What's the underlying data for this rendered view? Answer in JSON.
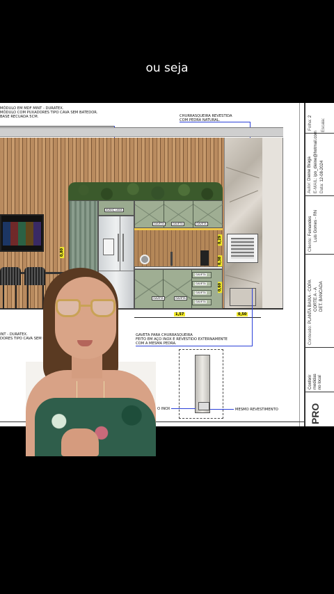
{
  "caption": "ou seja",
  "notes": {
    "top_left": "MÓDULO EM MDF MINT - DURATEX.\nMÓDULO COM PUXADORES TIPO CAVA SEM BATEDOR.\nBASE RECUADA 5CM.",
    "top_right": "CHURRASQUEIRA REVESTIDA\nCOM PEDRA NATURAL.",
    "mid_left": "INT - DURATEX.\nDORES TIPO CAVA SEM B",
    "gaveta": "GAVETA PARA CHURRASQUEIRA\nFEITO EM AÇO INOX E REVESTIDO EXTERNAMENTE\nCOM A MESMA PEDRA.",
    "inox": "O INOX",
    "revestimento": "MESMO REVESTIMENTO"
  },
  "dimensions": {
    "d1": "1,57",
    "d2": "0,50",
    "d3": "0,29",
    "d4": "0,38",
    "d5": "0,80",
    "d6": "0,60"
  },
  "cabinet_labels": {
    "upper_top": "AVANÇ LAMA",
    "upper_a": "GAVETA",
    "upper_b": "GAVETA",
    "upper_c": "GAVETA",
    "lower_a": "GAVETA",
    "lower_b": "GAVETA",
    "drawer_1": "GAVETA",
    "drawer_2": "GAVETA",
    "drawer_3": "GAVETA",
    "drawer_4": "GAVETA"
  },
  "title_block": {
    "folha_label": "Folha:",
    "folha_value": "2",
    "escala_label": "Escala:",
    "autor_label": "Autor:",
    "autor_value": "Dieine Braga",
    "email_label": "E-MAIL:",
    "email_value": "ipo_dieine@hotmail.com",
    "data_label": "Data:",
    "data_value": "12-08-2024",
    "cliente_label": "Cliente:",
    "cliente_value": "Fernandes",
    "cliente_city": "Luis Gomes - RN",
    "conteudo_label": "Conteúdo:",
    "conteudo_line1": "PLANTA BAIXA - COPA",
    "conteudo_line2": "CORTE A - A",
    "conteudo_line3": "DET. BANCADA",
    "conteudo_notes": "Conferir\nmedidas\nno local",
    "logo": "PRO"
  }
}
